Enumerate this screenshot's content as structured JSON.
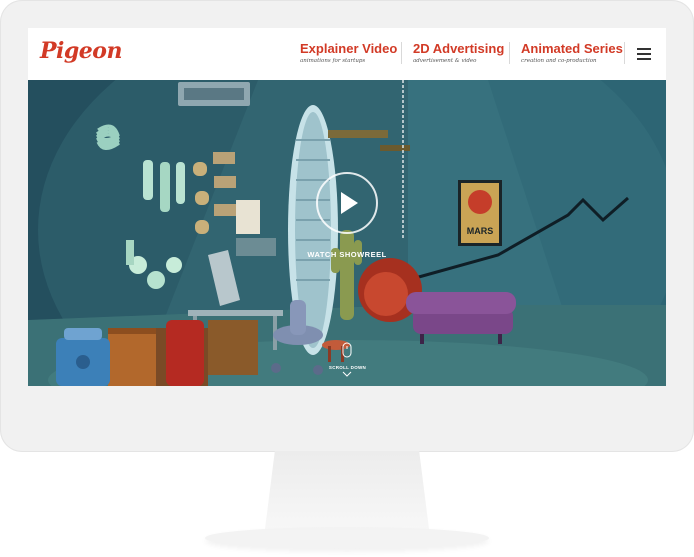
{
  "brand": {
    "logo_text": "Pigeon",
    "accent_color": "#d23a26"
  },
  "nav": {
    "items": [
      {
        "title": "Explainer Video",
        "subtitle": "animations for startups"
      },
      {
        "title": "2D Advertising",
        "subtitle": "advertisement & video"
      },
      {
        "title": "Animated Series",
        "subtitle": "creation and co-production"
      }
    ],
    "menu_icon": "hamburger-icon"
  },
  "hero": {
    "play_icon": "play-icon",
    "cta_label": "WATCH SHOWREEL",
    "scroll_label": "SCROLL DOWN",
    "scroll_icon": "chevron-down-icon",
    "mouse_icon": "mouse-icon",
    "poster_text": "MARS"
  }
}
